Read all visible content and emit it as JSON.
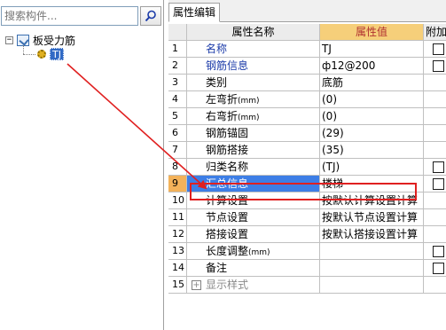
{
  "search": {
    "placeholder": "搜索构件..."
  },
  "tree": {
    "root": {
      "expander": "−",
      "label": "板受力筋"
    },
    "child": {
      "label": "TJ"
    }
  },
  "panel": {
    "tab_label": "属性编辑"
  },
  "table": {
    "headers": {
      "name": "属性名称",
      "value": "属性值",
      "add": "附加"
    },
    "rows": [
      {
        "num": "1",
        "name": "名称",
        "value": "TJ"
      },
      {
        "num": "2",
        "name": "钢筋信息",
        "value": "ф12@200"
      },
      {
        "num": "3",
        "name": "类别",
        "value": "底筋"
      },
      {
        "num": "4",
        "name": "左弯折",
        "unit": "(mm)",
        "value": "(0)"
      },
      {
        "num": "5",
        "name": "右弯折",
        "unit": "(mm)",
        "value": "(0)"
      },
      {
        "num": "6",
        "name": "钢筋锚固",
        "value": "(29)"
      },
      {
        "num": "7",
        "name": "钢筋搭接",
        "value": "(35)"
      },
      {
        "num": "8",
        "name": "归类名称",
        "value": "(TJ)"
      },
      {
        "num": "9",
        "name": "汇总信息",
        "value": "楼梯"
      },
      {
        "num": "10",
        "name": "计算设置",
        "value": "按默认计算设置计算"
      },
      {
        "num": "11",
        "name": "节点设置",
        "value": "按默认节点设置计算"
      },
      {
        "num": "12",
        "name": "搭接设置",
        "value": "按默认搭接设置计算"
      },
      {
        "num": "13",
        "name": "长度调整",
        "unit": "(mm)",
        "value": ""
      },
      {
        "num": "14",
        "name": "备注",
        "value": ""
      },
      {
        "num": "15",
        "expander": "+",
        "name": "显示样式",
        "value": ""
      }
    ]
  },
  "colors": {
    "annotation": "#e02020",
    "selection": "#3d7ee6",
    "header_value_bg": "#f6cf7a",
    "blue_text": "#1a3aa8"
  }
}
